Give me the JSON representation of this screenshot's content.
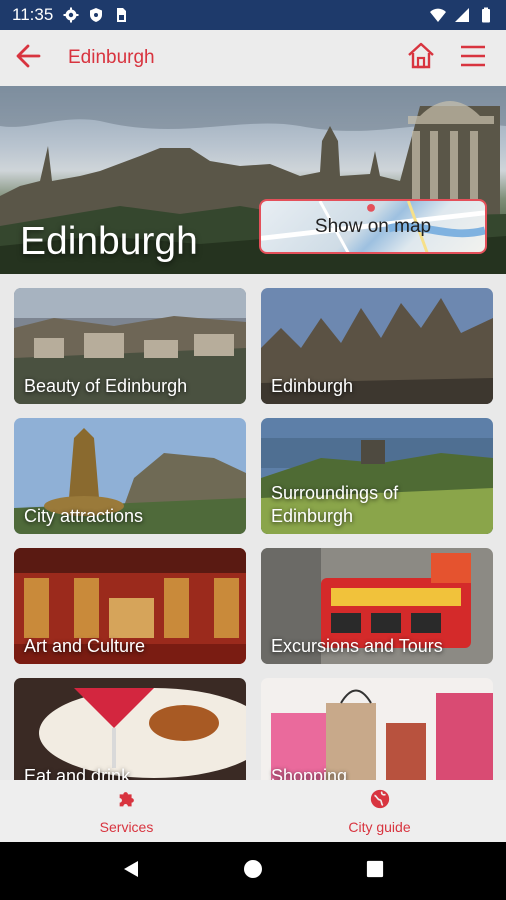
{
  "status_bar": {
    "time": "11:35",
    "left_icons": [
      "gear-icon",
      "shield-icon",
      "sim-card-icon"
    ],
    "right_icons": [
      "wifi-icon",
      "signal-icon",
      "battery-icon"
    ]
  },
  "app_bar": {
    "title": "Edinburgh",
    "back_icon": "arrow-left-icon",
    "actions": [
      "home-icon",
      "menu-icon"
    ],
    "accent": "#d8343f"
  },
  "hero": {
    "title": "Edinburgh",
    "map_button_label": "Show on map"
  },
  "tiles": [
    {
      "label": "Beauty of Edinburgh"
    },
    {
      "label": "Edinburgh"
    },
    {
      "label": "City attractions"
    },
    {
      "label": "Surroundings of Edinburgh"
    },
    {
      "label": "Art and Culture"
    },
    {
      "label": "Excursions and Tours"
    },
    {
      "label": "Eat and drink"
    },
    {
      "label": "Shopping"
    }
  ],
  "bottom_nav": {
    "items": [
      {
        "label": "Services",
        "icon": "puzzle-icon"
      },
      {
        "label": "City guide",
        "icon": "globe-icon"
      }
    ]
  },
  "system_nav": [
    "back-triangle-icon",
    "home-circle-icon",
    "recents-square-icon"
  ]
}
